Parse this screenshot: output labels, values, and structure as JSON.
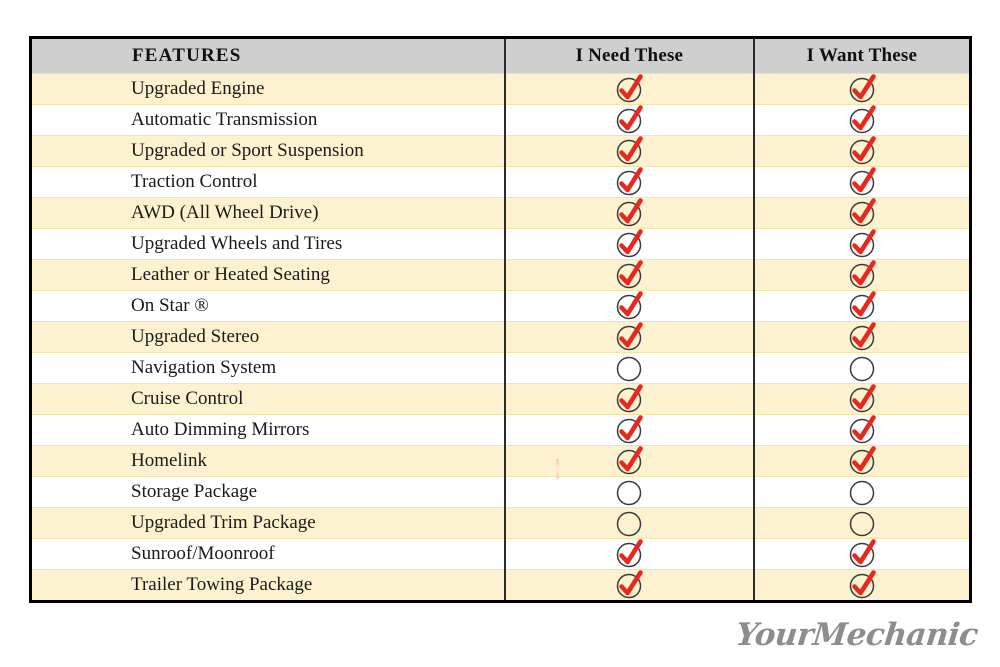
{
  "table": {
    "columns": [
      {
        "key": "feature",
        "label": "FEATURES"
      },
      {
        "key": "need",
        "label": "I Need These"
      },
      {
        "key": "want",
        "label": "I Want These"
      }
    ],
    "rows": [
      {
        "feature": "Upgraded Engine",
        "need": "checked",
        "want": "checked"
      },
      {
        "feature": "Automatic Transmission",
        "need": "checked",
        "want": "checked"
      },
      {
        "feature": "Upgraded or Sport Suspension",
        "need": "checked",
        "want": "checked"
      },
      {
        "feature": "Traction Control",
        "need": "checked",
        "want": "checked"
      },
      {
        "feature": "AWD (All Wheel Drive)",
        "need": "checked",
        "want": "checked"
      },
      {
        "feature": "Upgraded Wheels and Tires",
        "need": "checked",
        "want": "checked"
      },
      {
        "feature": "Leather or Heated Seating",
        "need": "checked",
        "want": "checked"
      },
      {
        "feature": "On Star ®",
        "need": "checked",
        "want": "checked"
      },
      {
        "feature": "Upgraded Stereo",
        "need": "checked",
        "want": "checked"
      },
      {
        "feature": "Navigation System",
        "need": "unchecked",
        "want": "unchecked"
      },
      {
        "feature": "Cruise Control",
        "need": "checked",
        "want": "checked"
      },
      {
        "feature": "Auto Dimming Mirrors",
        "need": "checked",
        "want": "checked"
      },
      {
        "feature": "Homelink",
        "need": "checked",
        "want": "checked"
      },
      {
        "feature": "Storage Package",
        "need": "unchecked",
        "want": "unchecked"
      },
      {
        "feature": "Upgraded Trim Package",
        "need": "unchecked",
        "want": "unchecked"
      },
      {
        "feature": "Sunroof/Moonroof",
        "need": "checked",
        "want": "checked"
      },
      {
        "feature": "Trailer Towing Package",
        "need": "checked",
        "want": "checked"
      }
    ]
  },
  "icons": {
    "checked": "check-mark-circle-icon",
    "unchecked": "empty-circle-icon"
  },
  "branding": {
    "logo_text": "YourMechanic"
  },
  "colors": {
    "header_background": "#cfcfcf",
    "row_alt_background": "#fdf2cf",
    "row_base_background": "#ffffff",
    "check_red": "#e8281e",
    "circle_outline": "#3a3a3a",
    "table_border": "#000000",
    "logo_gray": "#8d8d8d"
  }
}
